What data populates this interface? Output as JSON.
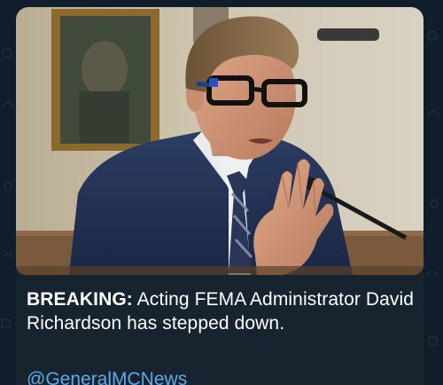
{
  "post": {
    "headline_lead": "BREAKING:",
    "headline_rest": " Acting FEMA Administrator David Richardson has stepped down.",
    "handle": "@GeneralMCNews"
  },
  "colors": {
    "background": "#0f1e2a",
    "card": "#17232f",
    "text": "#ffffff",
    "link": "#5ea9e6"
  },
  "photo": {
    "subject": "man-in-glasses-speaking-at-microphone"
  }
}
